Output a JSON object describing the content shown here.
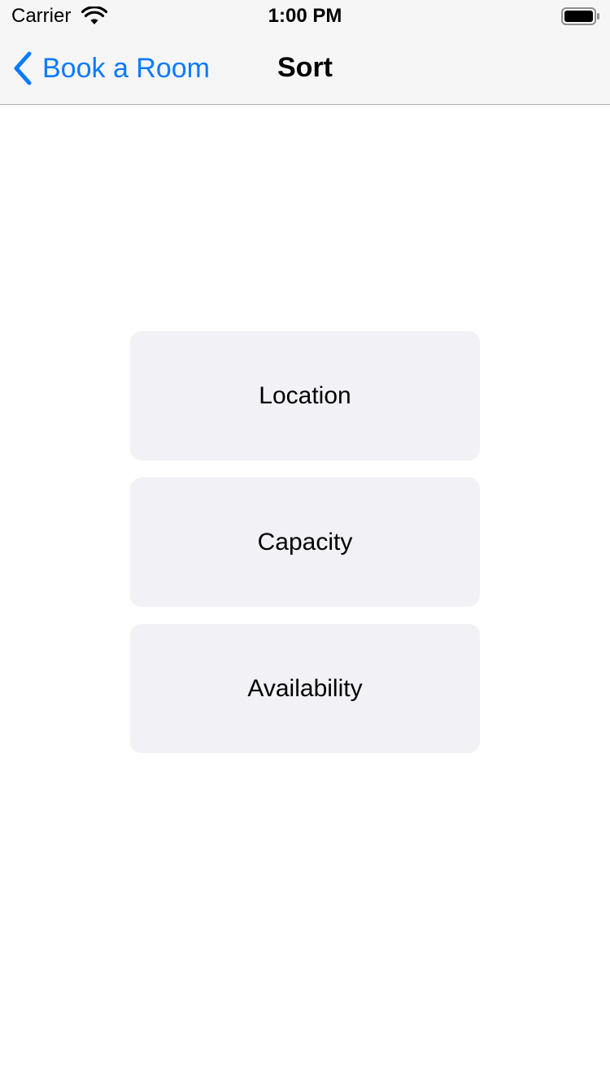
{
  "status_bar": {
    "carrier": "Carrier",
    "time": "1:00 PM",
    "wifi_icon": "wifi-icon",
    "battery_icon": "battery-icon"
  },
  "nav_bar": {
    "back_label": "Book a Room",
    "back_icon": "chevron-left-icon",
    "title": "Sort",
    "accent_color": "#0a7aff"
  },
  "sort_options": [
    {
      "label": "Location"
    },
    {
      "label": "Capacity"
    },
    {
      "label": "Availability"
    }
  ],
  "colors": {
    "option_background": "#f1f1f6",
    "bar_background": "#f6f6f6"
  }
}
